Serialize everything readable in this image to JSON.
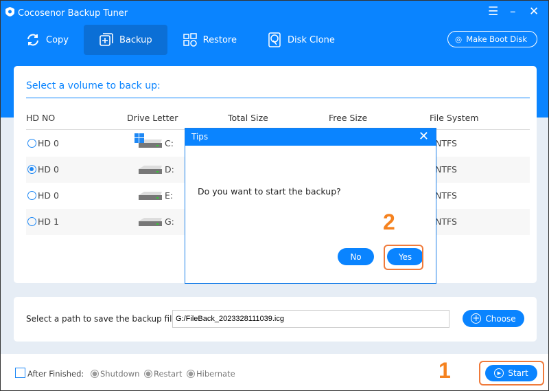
{
  "app": {
    "title": "Cocosenor Backup Tuner"
  },
  "nav": {
    "items": [
      {
        "label": "Copy",
        "icon": "sync-icon"
      },
      {
        "label": "Backup",
        "icon": "plus-square-icon",
        "active": true
      },
      {
        "label": "Restore",
        "icon": "restore-icon"
      },
      {
        "label": "Disk Clone",
        "icon": "disk-clone-icon"
      }
    ],
    "boot_label": "Make Boot Disk"
  },
  "volume": {
    "heading": "Select a volume to back up:",
    "columns": [
      "HD NO",
      "Drive Letter",
      "Total Size",
      "Free Size",
      "File System"
    ],
    "rows": [
      {
        "hd": "HD 0",
        "drive": "C:",
        "fs": "NTFS",
        "selected": false,
        "system": true
      },
      {
        "hd": "HD 0",
        "drive": "D:",
        "fs": "NTFS",
        "selected": true
      },
      {
        "hd": "HD 0",
        "drive": "E:",
        "fs": "NTFS",
        "selected": false
      },
      {
        "hd": "HD 1",
        "drive": "G:",
        "fs": "NTFS",
        "selected": false
      }
    ]
  },
  "path": {
    "label": "Select a path to save the backup file:",
    "value": "G:/FileBack_2023328111039.icg",
    "choose": "Choose"
  },
  "bottom": {
    "after_label": "After Finished:",
    "options": [
      "Shutdown",
      "Restart",
      "Hibernate"
    ],
    "start": "Start"
  },
  "dialog": {
    "title": "Tips",
    "message": "Do you want to start the backup?",
    "no": "No",
    "yes": "Yes"
  },
  "annotations": {
    "step1": "1",
    "step2": "2"
  },
  "colors": {
    "accent": "#0a84ff",
    "highlight": "#f07a3a"
  }
}
